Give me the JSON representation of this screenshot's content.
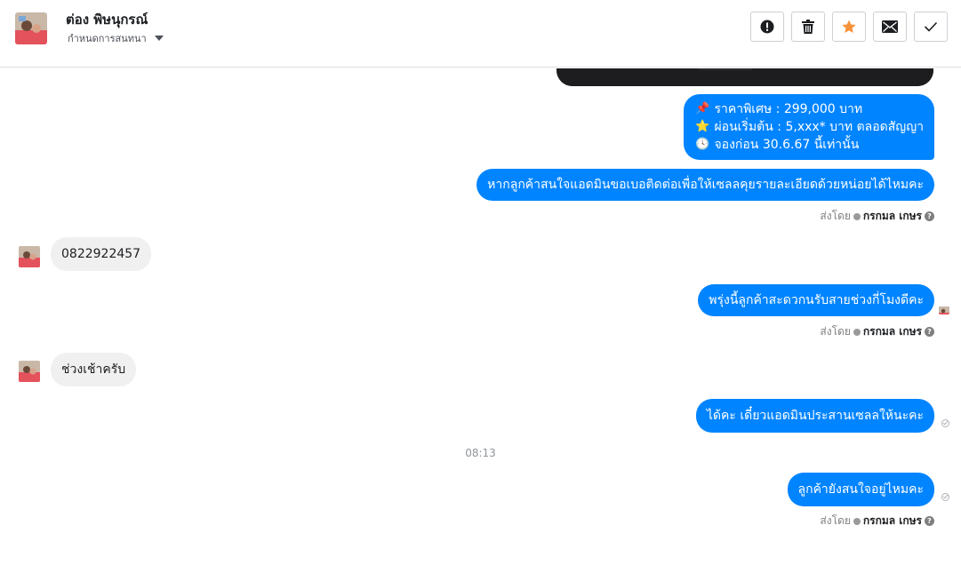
{
  "header": {
    "contact_name": "ต่อง พิษนุกรณ์",
    "settings_label": "กำหนดการสนทนา",
    "actions": [
      {
        "icon": "alert-icon"
      },
      {
        "icon": "trash-icon"
      },
      {
        "icon": "star-icon",
        "color": "#f7923a"
      },
      {
        "icon": "mail-icon"
      },
      {
        "icon": "check-icon"
      }
    ]
  },
  "messages": {
    "promo_lines": [
      {
        "icon": "📌",
        "text": "ราคาพิเศษ : 299,000 บาท"
      },
      {
        "icon": "⭐",
        "text": "ผ่อนเริ่มต้น : 5,xxx* บาท  ตลอดสัญญา"
      },
      {
        "icon": "🕓",
        "text": "จองก่อน 30.6.67 นี้เท่านั้น"
      }
    ],
    "msg_phone_request": "หากลูกค้าสนใจแอดมินขอเบอติดต่อเพื่อให้เซลลคุยรายละเอียดด้วยหน่อยได้ไหมคะ",
    "msg_phone_reply": "0822922457",
    "msg_time_question": "พรุ่งนี้ลูกค้าสะดวกนรับสายช่วงกี่โมงดีคะ",
    "msg_time_reply": "ช่วงเช้าครับ",
    "msg_confirm": "ได้คะ เดี๋ยวแอดมินประสานเซลลให้นะคะ",
    "timestamp": "08:13",
    "msg_followup": "ลูกค้ายังสนใจอยู่ไหมคะ"
  },
  "sent_by": {
    "prefix": "ส่งโดย",
    "name": "กรกมล เกษร"
  },
  "colors": {
    "outgoing_bubble": "#0084ff",
    "incoming_bubble": "#f1f0f0",
    "star": "#f7923a"
  }
}
